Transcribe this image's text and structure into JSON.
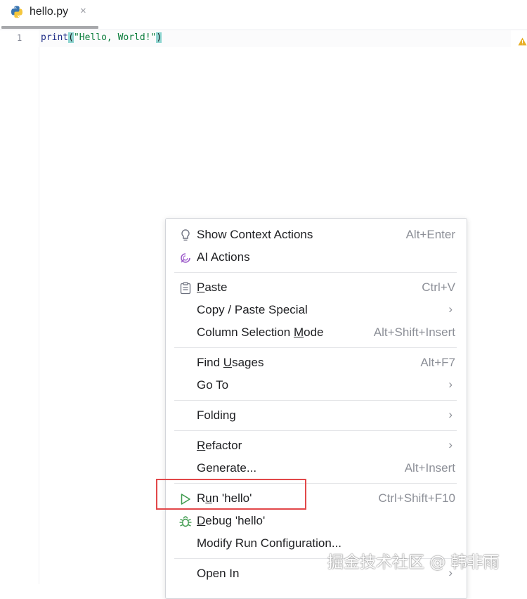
{
  "tab": {
    "file_name": "hello.py",
    "close_glyph": "×"
  },
  "editor": {
    "line_number": "1",
    "code": {
      "fn": "print",
      "open": "(",
      "str": "\"Hello, World!\"",
      "close": ")"
    }
  },
  "menu": {
    "items": [
      {
        "label": "Show Context Actions",
        "shortcut": "Alt+Enter",
        "icon": "lightbulb-icon"
      },
      {
        "label": "AI Actions",
        "shortcut": "",
        "icon": "ai-spiral-icon"
      },
      {
        "label_pre": "",
        "label_u": "P",
        "label_post": "aste",
        "shortcut": "Ctrl+V",
        "icon": "clipboard-icon"
      },
      {
        "label": "Copy / Paste Special",
        "submenu": "›"
      },
      {
        "label_pre": "Column Selection ",
        "label_u": "M",
        "label_post": "ode",
        "shortcut": "Alt+Shift+Insert"
      },
      {
        "label_pre": "Find ",
        "label_u": "U",
        "label_post": "sages",
        "shortcut": "Alt+F7"
      },
      {
        "label": "Go To",
        "submenu": "›"
      },
      {
        "label": "Folding",
        "submenu": "›"
      },
      {
        "label_pre": "",
        "label_u": "R",
        "label_post": "efactor",
        "submenu": "›"
      },
      {
        "label": "Generate...",
        "shortcut": "Alt+Insert"
      },
      {
        "label_pre": "R",
        "label_u": "u",
        "label_post": "n 'hello'",
        "shortcut": "Ctrl+Shift+F10",
        "icon": "run-triangle-icon"
      },
      {
        "label_pre": "",
        "label_u": "D",
        "label_post": "ebug 'hello'",
        "icon": "bug-icon"
      },
      {
        "label": "Modify Run Configuration..."
      },
      {
        "label": "Open In",
        "submenu": "›"
      }
    ]
  },
  "watermark": "掘金技术社区 @ 韩非雨",
  "colors": {
    "accent_highlight": "#e2484a",
    "run_green": "#3e9a4d",
    "ai_purple": "#9b59c8"
  }
}
